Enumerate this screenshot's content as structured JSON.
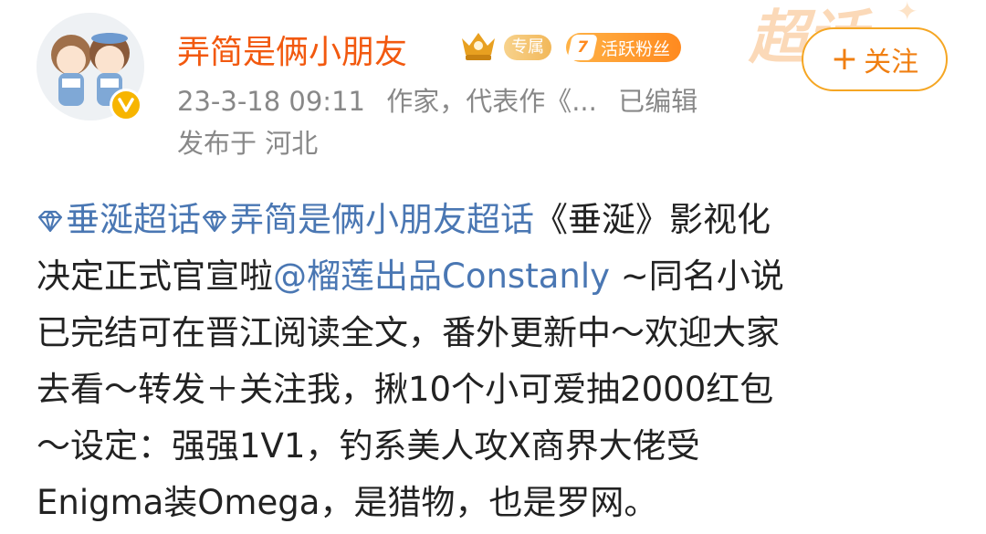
{
  "post": {
    "author": {
      "name": "弄简是俩小朋友",
      "tag_exclusive": "专属",
      "fans_level": "7",
      "fans_label": "活跃粉丝",
      "verified_icon": "verified-v-icon",
      "badge_icon": "crown-badge-icon"
    },
    "follow_button": {
      "label": "关注",
      "icon": "plus-icon"
    },
    "meta": {
      "timestamp": "23-3-18 09:11",
      "description": "作家，代表作《...",
      "edited": "已编辑",
      "location": "发布于 河北"
    },
    "watermark": "超话",
    "content": {
      "topic1": "垂涎超话",
      "topic2": "弄简是俩小朋友超话",
      "l1_tail": "《垂涎》影视化",
      "l2_head": "决定正式官宣啦",
      "mention": "@榴莲出品Constanly",
      "l2_tail": " ~同名小说",
      "line3": "已完结可在晋江阅读全文，番外更新中～欢迎大家",
      "line4": "去看～转发＋关注我，揪10个小可爱抽2000红包",
      "line5": "～设定：强强1V1，钓系美人攻X商界大佬受",
      "line6": "Enigma装Omega，是猎物，也是罗网。"
    },
    "colors": {
      "username": "#f2590f",
      "link": "#4a77b3",
      "meta": "#888888",
      "follow_border": "#f5a623",
      "text": "#222222"
    }
  }
}
